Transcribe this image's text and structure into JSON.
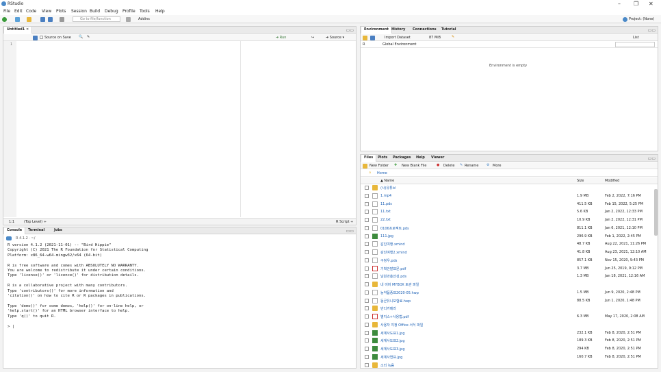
{
  "window": {
    "title": "RStudio",
    "project": "Project: (None)"
  },
  "menu": [
    "File",
    "Edit",
    "Code",
    "View",
    "Plots",
    "Session",
    "Build",
    "Debug",
    "Profile",
    "Tools",
    "Help"
  ],
  "toolbar": {
    "goto_placeholder": "Go to file/function",
    "addins": "Addins"
  },
  "editor": {
    "tab": "Untitled1",
    "source_on_save": "Source on Save",
    "run": "Run",
    "source": "Source",
    "line_number": "1",
    "status_position": "1:1",
    "status_scope": "(Top Level) ÷",
    "status_type": "R Script ÷"
  },
  "console": {
    "tabs": [
      "Console",
      "Terminal",
      "Jobs"
    ],
    "path": "R 4.1.2 · ~/",
    "lines": [
      "R version 4.1.2 (2021-11-01) -- \"Bird Hippie\"",
      "Copyright (C) 2021 The R Foundation for Statistical Computing",
      "Platform: x86_64-w64-mingw32/x64 (64-bit)",
      "",
      "R is free software and comes with ABSOLUTELY NO WARRANTY.",
      "You are welcome to redistribute it under certain conditions.",
      "Type 'license()' or 'licence()' for distribution details.",
      "",
      "R is a collaborative project with many contributors.",
      "Type 'contributors()' for more information and",
      "'citation()' on how to cite R or R packages in publications.",
      "",
      "Type 'demo()' for some demos, 'help()' for on-line help, or",
      "'help.start()' for an HTML browser interface to help.",
      "Type 'q()' to quit R.",
      "",
      "> |"
    ]
  },
  "env": {
    "tabs": [
      "Environment",
      "History",
      "Connections",
      "Tutorial"
    ],
    "import": "Import Dataset",
    "memory": "87 MiB",
    "list": "List",
    "lang": "R",
    "scope": "Global Environment",
    "empty": "Environment is empty"
  },
  "files": {
    "tabs": [
      "Files",
      "Plots",
      "Packages",
      "Help",
      "Viewer"
    ],
    "new_folder": "New Folder",
    "new_blank": "New Blank File",
    "delete": "Delete",
    "rename": "Rename",
    "more": "More",
    "home": "Home",
    "headers": {
      "name": "▲ Name",
      "size": "Size",
      "modified": "Modified"
    },
    "rows": [
      {
        "type": "folder",
        "name": "(사)유튜브",
        "size": "",
        "modified": ""
      },
      {
        "type": "file",
        "name": "1.mp4",
        "size": "1.9 MB",
        "modified": "Feb 2, 2022, 7:16 PM"
      },
      {
        "type": "file",
        "name": "11.pds",
        "size": "411.5 KB",
        "modified": "Feb 15, 2022, 5:25 PM"
      },
      {
        "type": "file",
        "name": "11.txt",
        "size": "5.6 KB",
        "modified": "Jan 2, 2022, 12:33 PM"
      },
      {
        "type": "file",
        "name": "22.txt",
        "size": "10.9 KB",
        "modified": "Jan 2, 2022, 12:31 PM"
      },
      {
        "type": "file",
        "name": "0106프로젝트.pds",
        "size": "811.1 KB",
        "modified": "Jan 6, 2021, 12:10 PM"
      },
      {
        "type": "image",
        "name": "111.jpg",
        "size": "296.9 KB",
        "modified": "Feb 1, 2022, 2:45 PM"
      },
      {
        "type": "file",
        "name": "감진여행.xmind",
        "size": "48.7 KB",
        "modified": "Aug 22, 2021, 11:26 PM"
      },
      {
        "type": "file",
        "name": "감진여행2.xmind",
        "size": "41.8 KB",
        "modified": "Aug 23, 2021, 12:10 AM"
      },
      {
        "type": "file",
        "name": "구청우.pds",
        "size": "857.1 KB",
        "modified": "Nov 15, 2020, 9:43 PM"
      },
      {
        "type": "pdf",
        "name": "기획안발표문.pdf",
        "size": "3.7 MB",
        "modified": "Jun 25, 2019, 9:12 PM"
      },
      {
        "type": "file",
        "name": "남원과총산성.pds",
        "size": "1.3 MB",
        "modified": "Jan 18, 2021, 12:16 AM"
      },
      {
        "type": "folder",
        "name": "내 이버 MYBOX 토관 파일",
        "size": "",
        "modified": ""
      },
      {
        "type": "file",
        "name": "농약품종표2020-05.hwp",
        "size": "1.5 MB",
        "modified": "Jun 9, 2020, 2:48 PM"
      },
      {
        "type": "file",
        "name": "동군유니보험료.hwp",
        "size": "88.5 KB",
        "modified": "Jun 1, 2020, 1:48 PM"
      },
      {
        "type": "folder",
        "name": "반디카메라",
        "size": "",
        "modified": ""
      },
      {
        "type": "pdf",
        "name": "별지스+사용법.pdf",
        "size": "6.3 MB",
        "modified": "May 17, 2020, 2:08 AM"
      },
      {
        "type": "folder",
        "name": "사용자 지정 Office 서식 파일",
        "size": "",
        "modified": ""
      },
      {
        "type": "image",
        "name": "세계사도표1.jpg",
        "size": "232.1 KB",
        "modified": "Feb 8, 2020, 2:51 PM"
      },
      {
        "type": "image",
        "name": "세계사도표2.jpg",
        "size": "189.3 KB",
        "modified": "Feb 8, 2020, 2:51 PM"
      },
      {
        "type": "image",
        "name": "세계사도표3.jpg",
        "size": "294 KB",
        "modified": "Feb 8, 2020, 2:51 PM"
      },
      {
        "type": "image",
        "name": "세계사연표.jpg",
        "size": "160.7 KB",
        "modified": "Feb 8, 2020, 2:51 PM"
      },
      {
        "type": "folder",
        "name": "소리 녹음",
        "size": "",
        "modified": ""
      }
    ]
  }
}
